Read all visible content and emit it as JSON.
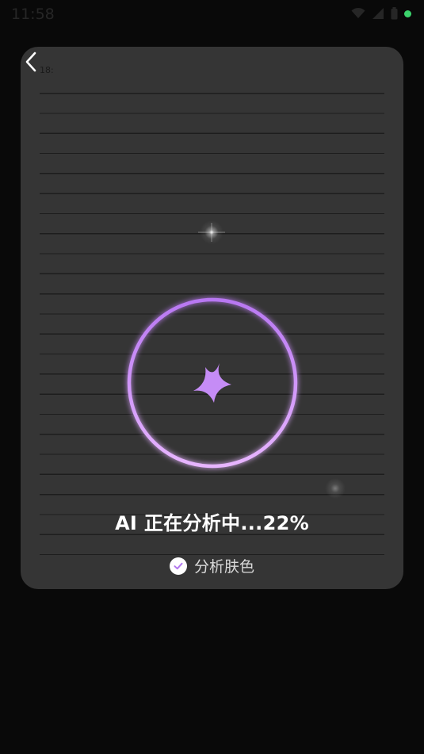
{
  "status_bar": {
    "time": "11:58",
    "icons": [
      "wifi-icon",
      "signal-icon",
      "battery-icon"
    ],
    "dot_color": "#3bd36c"
  },
  "card": {
    "faint_text": "18:",
    "background": "#353535"
  },
  "analysis": {
    "progress": 0.22,
    "status_text": "AI 正在分析中...22%",
    "ring_gradient": [
      "#b877f2",
      "#e7b5ff"
    ],
    "center_icon": "sparkle-star-icon",
    "accent": "#c58cf6"
  },
  "steps": [
    {
      "label": "分析肤色",
      "state": "done",
      "icon": "check-icon"
    }
  ]
}
